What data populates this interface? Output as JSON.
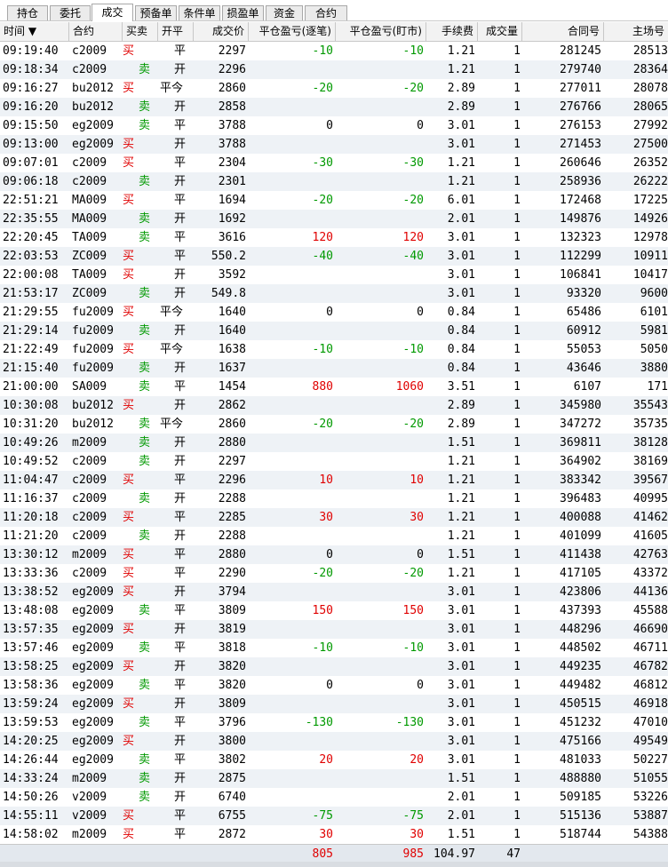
{
  "tabs": [
    "持仓",
    "委托",
    "成交",
    "预备单",
    "条件单",
    "损盈单",
    "资金",
    "合约"
  ],
  "active_tab": 2,
  "columns": [
    "时间 ▼",
    "合约",
    "买卖",
    "开平",
    "成交价",
    "平仓盈亏(逐笔)",
    "平仓盈亏(盯市)",
    "手续费",
    "成交量",
    "合同号",
    "主场号"
  ],
  "rows": [
    [
      "09:19:40",
      "c2009",
      "买",
      "平",
      "2297",
      "-10",
      "-10",
      "1.21",
      "1",
      "281245",
      "28513"
    ],
    [
      "09:18:34",
      "c2009",
      "卖",
      "开",
      "2296",
      "",
      "",
      "1.21",
      "1",
      "279740",
      "28364"
    ],
    [
      "09:16:27",
      "bu2012",
      "买",
      "平今",
      "2860",
      "-20",
      "-20",
      "2.89",
      "1",
      "277011",
      "28078"
    ],
    [
      "09:16:20",
      "bu2012",
      "卖",
      "开",
      "2858",
      "",
      "",
      "2.89",
      "1",
      "276766",
      "28065"
    ],
    [
      "09:15:50",
      "eg2009",
      "卖",
      "平",
      "3788",
      "0",
      "0",
      "3.01",
      "1",
      "276153",
      "27992"
    ],
    [
      "09:13:00",
      "eg2009",
      "买",
      "开",
      "3788",
      "",
      "",
      "3.01",
      "1",
      "271453",
      "27500"
    ],
    [
      "09:07:01",
      "c2009",
      "买",
      "平",
      "2304",
      "-30",
      "-30",
      "1.21",
      "1",
      "260646",
      "26352"
    ],
    [
      "09:06:18",
      "c2009",
      "卖",
      "开",
      "2301",
      "",
      "",
      "1.21",
      "1",
      "258936",
      "26222"
    ],
    [
      "22:51:21",
      "MA009",
      "买",
      "平",
      "1694",
      "-20",
      "-20",
      "6.01",
      "1",
      "172468",
      "17225"
    ],
    [
      "22:35:55",
      "MA009",
      "卖",
      "开",
      "1692",
      "",
      "",
      "2.01",
      "1",
      "149876",
      "14926"
    ],
    [
      "22:20:45",
      "TA009",
      "卖",
      "平",
      "3616",
      "120",
      "120",
      "3.01",
      "1",
      "132323",
      "12978"
    ],
    [
      "22:03:53",
      "ZC009",
      "买",
      "平",
      "550.2",
      "-40",
      "-40",
      "3.01",
      "1",
      "112299",
      "10911"
    ],
    [
      "22:00:08",
      "TA009",
      "买",
      "开",
      "3592",
      "",
      "",
      "3.01",
      "1",
      "106841",
      "10417"
    ],
    [
      "21:53:17",
      "ZC009",
      "卖",
      "开",
      "549.8",
      "",
      "",
      "3.01",
      "1",
      "93320",
      "9600"
    ],
    [
      "21:29:55",
      "fu2009",
      "买",
      "平今",
      "1640",
      "0",
      "0",
      "0.84",
      "1",
      "65486",
      "6101"
    ],
    [
      "21:29:14",
      "fu2009",
      "卖",
      "开",
      "1640",
      "",
      "",
      "0.84",
      "1",
      "60912",
      "5981"
    ],
    [
      "21:22:49",
      "fu2009",
      "买",
      "平今",
      "1638",
      "-10",
      "-10",
      "0.84",
      "1",
      "55053",
      "5050"
    ],
    [
      "21:15:40",
      "fu2009",
      "卖",
      "开",
      "1637",
      "",
      "",
      "0.84",
      "1",
      "43646",
      "3880"
    ],
    [
      "21:00:00",
      "SA009",
      "卖",
      "平",
      "1454",
      "880",
      "1060",
      "3.51",
      "1",
      "6107",
      "171"
    ],
    [
      "10:30:08",
      "bu2012",
      "买",
      "开",
      "2862",
      "",
      "",
      "2.89",
      "1",
      "345980",
      "35543"
    ],
    [
      "10:31:20",
      "bu2012",
      "卖",
      "平今",
      "2860",
      "-20",
      "-20",
      "2.89",
      "1",
      "347272",
      "35735"
    ],
    [
      "10:49:26",
      "m2009",
      "卖",
      "开",
      "2880",
      "",
      "",
      "1.51",
      "1",
      "369811",
      "38128"
    ],
    [
      "10:49:52",
      "c2009",
      "卖",
      "开",
      "2297",
      "",
      "",
      "1.21",
      "1",
      "364902",
      "38169"
    ],
    [
      "11:04:47",
      "c2009",
      "买",
      "平",
      "2296",
      "10",
      "10",
      "1.21",
      "1",
      "383342",
      "39567"
    ],
    [
      "11:16:37",
      "c2009",
      "卖",
      "开",
      "2288",
      "",
      "",
      "1.21",
      "1",
      "396483",
      "40995"
    ],
    [
      "11:20:18",
      "c2009",
      "买",
      "平",
      "2285",
      "30",
      "30",
      "1.21",
      "1",
      "400088",
      "41462"
    ],
    [
      "11:21:20",
      "c2009",
      "卖",
      "开",
      "2288",
      "",
      "",
      "1.21",
      "1",
      "401099",
      "41605"
    ],
    [
      "13:30:12",
      "m2009",
      "买",
      "平",
      "2880",
      "0",
      "0",
      "1.51",
      "1",
      "411438",
      "42763"
    ],
    [
      "13:33:36",
      "c2009",
      "买",
      "平",
      "2290",
      "-20",
      "-20",
      "1.21",
      "1",
      "417105",
      "43372"
    ],
    [
      "13:38:52",
      "eg2009",
      "买",
      "开",
      "3794",
      "",
      "",
      "3.01",
      "1",
      "423806",
      "44136"
    ],
    [
      "13:48:08",
      "eg2009",
      "卖",
      "平",
      "3809",
      "150",
      "150",
      "3.01",
      "1",
      "437393",
      "45588"
    ],
    [
      "13:57:35",
      "eg2009",
      "买",
      "开",
      "3819",
      "",
      "",
      "3.01",
      "1",
      "448296",
      "46690"
    ],
    [
      "13:57:46",
      "eg2009",
      "卖",
      "平",
      "3818",
      "-10",
      "-10",
      "3.01",
      "1",
      "448502",
      "46711"
    ],
    [
      "13:58:25",
      "eg2009",
      "买",
      "开",
      "3820",
      "",
      "",
      "3.01",
      "1",
      "449235",
      "46782"
    ],
    [
      "13:58:36",
      "eg2009",
      "卖",
      "平",
      "3820",
      "0",
      "0",
      "3.01",
      "1",
      "449482",
      "46812"
    ],
    [
      "13:59:24",
      "eg2009",
      "买",
      "开",
      "3809",
      "",
      "",
      "3.01",
      "1",
      "450515",
      "46918"
    ],
    [
      "13:59:53",
      "eg2009",
      "卖",
      "平",
      "3796",
      "-130",
      "-130",
      "3.01",
      "1",
      "451232",
      "47010"
    ],
    [
      "14:20:25",
      "eg2009",
      "买",
      "开",
      "3800",
      "",
      "",
      "3.01",
      "1",
      "475166",
      "49549"
    ],
    [
      "14:26:44",
      "eg2009",
      "卖",
      "平",
      "3802",
      "20",
      "20",
      "3.01",
      "1",
      "481033",
      "50227"
    ],
    [
      "14:33:24",
      "m2009",
      "卖",
      "开",
      "2875",
      "",
      "",
      "1.51",
      "1",
      "488880",
      "51055"
    ],
    [
      "14:50:26",
      "v2009",
      "卖",
      "开",
      "6740",
      "",
      "",
      "2.01",
      "1",
      "509185",
      "53226"
    ],
    [
      "14:55:11",
      "v2009",
      "买",
      "平",
      "6755",
      "-75",
      "-75",
      "2.01",
      "1",
      "515136",
      "53887"
    ],
    [
      "14:58:02",
      "m2009",
      "买",
      "平",
      "2872",
      "30",
      "30",
      "1.51",
      "1",
      "518744",
      "54388"
    ]
  ],
  "totals": {
    "pnl_each": "805",
    "pnl_market": "985",
    "fee": "104.97",
    "volume": "47"
  },
  "colors": {
    "buy": "#e00000",
    "sell": "#009900",
    "loss": "#009900",
    "profit": "#e00000",
    "alt_row": "#eef2f6",
    "header_bg": "#f2f2f2"
  }
}
